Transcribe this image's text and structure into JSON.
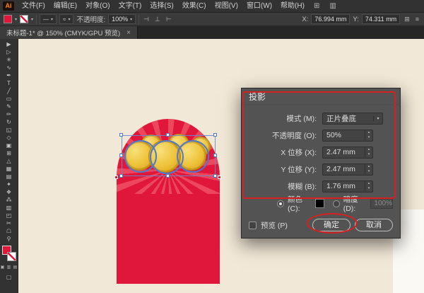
{
  "app": {
    "logo": "Ai"
  },
  "menubar": {
    "items": [
      "文件(F)",
      "编辑(E)",
      "对象(O)",
      "文字(T)",
      "选择(S)",
      "效果(C)",
      "视图(V)",
      "窗口(W)",
      "帮助(H)"
    ]
  },
  "controlbar": {
    "opacity_label": "不透明度:",
    "opacity_value": "100%",
    "x_label": "X:",
    "x_value": "76.994 mm",
    "y_label": "Y:",
    "y_value": "74.311 mm"
  },
  "tabbar": {
    "title": "未标题-1* @ 150% (CMYK/GPU 预览)"
  },
  "toolbar": {
    "tools": [
      {
        "name": "selection-tool",
        "glyph": "▶"
      },
      {
        "name": "direct-selection-tool",
        "glyph": "▷"
      },
      {
        "name": "magic-wand-tool",
        "glyph": "✳"
      },
      {
        "name": "lasso-tool",
        "glyph": "∿"
      },
      {
        "name": "pen-tool",
        "glyph": "✒"
      },
      {
        "name": "type-tool",
        "glyph": "T"
      },
      {
        "name": "line-segment-tool",
        "glyph": "╱"
      },
      {
        "name": "rectangle-tool",
        "glyph": "▭"
      },
      {
        "name": "paintbrush-tool",
        "glyph": "✎"
      },
      {
        "name": "pencil-tool",
        "glyph": "✏"
      },
      {
        "name": "rotate-tool",
        "glyph": "↻"
      },
      {
        "name": "scale-tool",
        "glyph": "◱"
      },
      {
        "name": "width-tool",
        "glyph": "◇"
      },
      {
        "name": "free-transform-tool",
        "glyph": "▣"
      },
      {
        "name": "shape-builder-tool",
        "glyph": "⊞"
      },
      {
        "name": "perspective-grid-tool",
        "glyph": "△"
      },
      {
        "name": "mesh-tool",
        "glyph": "▦"
      },
      {
        "name": "gradient-tool",
        "glyph": "▤"
      },
      {
        "name": "eyedropper-tool",
        "glyph": "✦"
      },
      {
        "name": "blend-tool",
        "glyph": "❖"
      },
      {
        "name": "symbol-sprayer-tool",
        "glyph": "⁂"
      },
      {
        "name": "column-graph-tool",
        "glyph": "▥"
      },
      {
        "name": "artboard-tool",
        "glyph": "◰"
      },
      {
        "name": "slice-tool",
        "glyph": "✂"
      },
      {
        "name": "hand-tool",
        "glyph": "☖"
      },
      {
        "name": "zoom-tool",
        "glyph": "⚲"
      }
    ]
  },
  "dialog": {
    "title": "投影",
    "rows": [
      {
        "label": "模式 (M):",
        "value": "正片叠底"
      },
      {
        "label": "不透明度 (O):",
        "value": "50%"
      },
      {
        "label": "X 位移 (X):",
        "value": "2.47 mm"
      },
      {
        "label": "Y 位移 (Y):",
        "value": "2.47 mm"
      },
      {
        "label": "模糊 (B):",
        "value": "1.76 mm"
      }
    ],
    "color_label": "颜色 (C):",
    "darkness_label": "暗度 (D):",
    "darkness_value": "100%",
    "preview_label": "预览 (P)",
    "ok_label": "确定",
    "cancel_label": "取消"
  },
  "icons": {
    "chevron_down": "▾",
    "stepper_up": "▴",
    "stepper_down": "▾",
    "close": "×",
    "menu_arrange": "⊞",
    "menu_workspace": "▥",
    "width_profile": "—",
    "brush": "≈",
    "align_left": "⊣",
    "align_center": "⊥",
    "align_right": "⊢",
    "panel_grid": "⊞",
    "panel_menu": "≡"
  },
  "colors": {
    "accent_red": "#e0173a",
    "coin_gold": "#eec23a",
    "selection_blue": "#4f79c9",
    "annotation_red": "#d42020",
    "canvas_cream": "#f2e8d7",
    "dialog_gray": "#535353"
  }
}
